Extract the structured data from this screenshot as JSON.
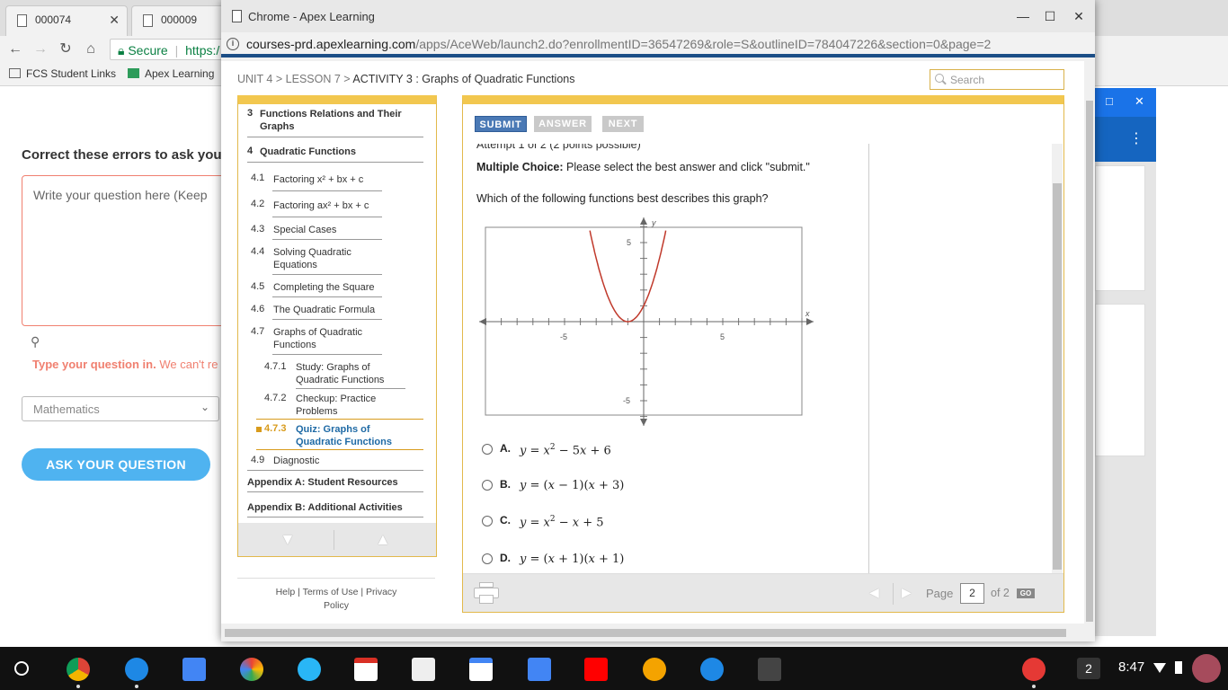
{
  "bg_browser": {
    "tabs": [
      "000074",
      "000009"
    ],
    "omnibox": {
      "secure_label": "Secure",
      "url_start": "https:/"
    },
    "bookmarks": [
      "FCS Student Links",
      "Apex Learning"
    ],
    "question_heading": "Correct these errors to ask you",
    "textarea_placeholder": "Write your question here (Keep",
    "error_bold": "Type your question in.",
    "error_rest": "We can't re",
    "subject_select": "Mathematics",
    "ask_button": "ASK YOUR QUESTION"
  },
  "window": {
    "title": "Chrome - Apex Learning",
    "url_host": "courses-prd.apexlearning.com",
    "url_path": "/apps/AceWeb/launch2.do?enrollmentID=36547269&role=S&outlineID=784047226&section=0&page=2"
  },
  "breadcrumb": {
    "unit": "UNIT 4",
    "sep": ">",
    "lesson": "LESSON 7",
    "activity": "ACTIVITY 3 : Graphs of Quadratic Functions"
  },
  "search": {
    "placeholder": "Search"
  },
  "sidebar": {
    "unit3": {
      "num": "3",
      "label_line1": "Functions Relations and Their",
      "label_line2": "Graphs"
    },
    "unit4": {
      "num": "4",
      "label": "Quadratic Functions"
    },
    "items": [
      {
        "num": "4.1",
        "label": "Factoring x² + bx + c"
      },
      {
        "num": "4.2",
        "label": "Factoring ax² + bx + c"
      },
      {
        "num": "4.3",
        "label": "Special Cases"
      },
      {
        "num": "4.4",
        "label_line1": "Solving Quadratic",
        "label_line2": "Equations"
      },
      {
        "num": "4.5",
        "label": "Completing the Square"
      },
      {
        "num": "4.6",
        "label": "The Quadratic Formula"
      },
      {
        "num": "4.7",
        "label_line1": "Graphs of Quadratic",
        "label_line2": "Functions"
      }
    ],
    "subitems": [
      {
        "num": "4.7.1",
        "label_line1": "Study: Graphs of",
        "label_line2": "Quadratic Functions"
      },
      {
        "num": "4.7.2",
        "label_line1": "Checkup: Practice",
        "label_line2": "Problems"
      },
      {
        "num": "4.7.3",
        "label_line1": "Quiz: Graphs of",
        "label_line2": "Quadratic Functions"
      }
    ],
    "item49": {
      "num": "4.9",
      "label": "Diagnostic"
    },
    "appendix_a": "Appendix A: Student Resources",
    "appendix_b": "Appendix B: Additional Activities"
  },
  "footer_links": {
    "help": "Help",
    "terms": "Terms of Use",
    "privacy": "Privacy",
    "policy": "Policy",
    "sep": "|"
  },
  "actions": {
    "submit": "SUBMIT",
    "answer": "ANSWER",
    "next": "NEXT"
  },
  "question": {
    "attempt": "Attempt 1 of 2 (2 points possible)",
    "mc_bold": "Multiple Choice:",
    "mc_rest": "Please select the best answer and click \"submit.\"",
    "prompt": "Which of the following functions best describes this graph?"
  },
  "graph": {
    "x_axis_label": "x",
    "y_axis_label": "y",
    "tick_labels": {
      "x_neg": "-5",
      "x_pos": "5",
      "y_pos": "5",
      "y_neg": "-5"
    },
    "xlim": [
      -10,
      10
    ],
    "ylim": [
      -6,
      6
    ],
    "curve_color": "#c0392b",
    "vertex": [
      -1,
      0
    ]
  },
  "choices": [
    {
      "letter": "A.",
      "parts": [
        "y",
        " = ",
        "x",
        "2",
        " − 5",
        "x",
        " + 6"
      ]
    },
    {
      "letter": "B.",
      "parts": [
        "y",
        " = (",
        "x",
        " − 1)(",
        "x",
        " + 3)"
      ]
    },
    {
      "letter": "C.",
      "parts": [
        "y",
        " = ",
        "x",
        "2",
        " − ",
        "x",
        " + 5"
      ]
    },
    {
      "letter": "D.",
      "parts": [
        "y",
        " = (",
        "x",
        " + 1)(",
        "x",
        " + 1)"
      ]
    }
  ],
  "pager": {
    "page_label": "Page",
    "page_value": "2",
    "of_label": "of 2",
    "go": "GO"
  },
  "taskbar": {
    "window_count": "2",
    "time": "8:47"
  }
}
